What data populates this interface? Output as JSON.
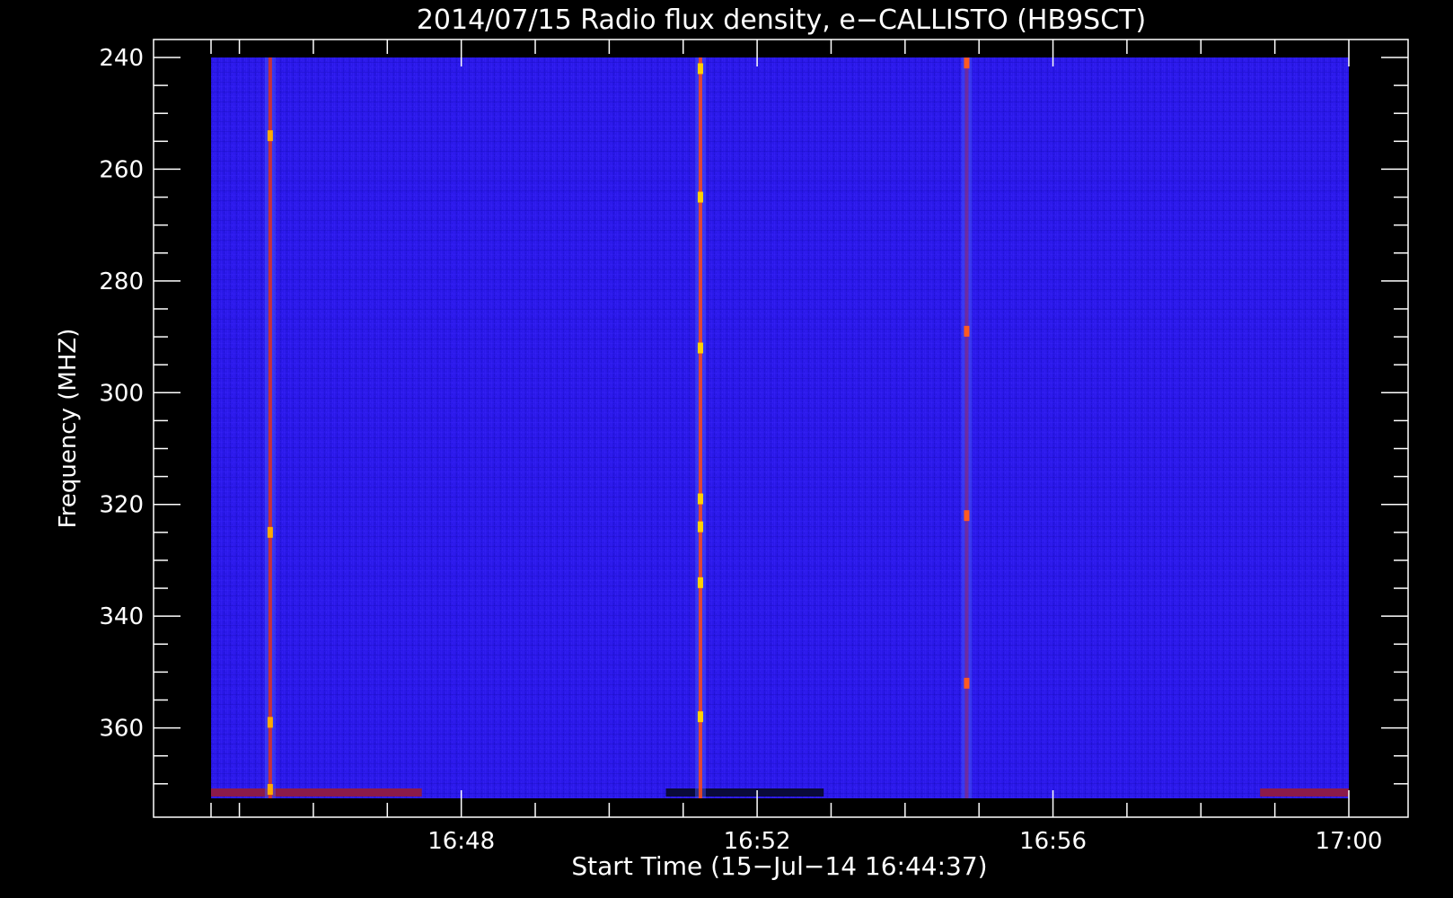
{
  "chart_data": {
    "type": "heatmap",
    "title": "2014/07/15  Radio flux density, e−CALLISTO (HB9SCT)",
    "xlabel": "Start Time (15−Jul−14 16:44:37)",
    "ylabel": "Frequency (MHZ)",
    "x_start": "16:44:37",
    "x_end": "17:00:00",
    "xlim": [
      "16:44:37",
      "17:00:00"
    ],
    "x_ticks": [
      "16:48",
      "16:52",
      "16:56",
      "17:00"
    ],
    "x_minor_tick_minutes": 1,
    "ylim": [
      240,
      372.6
    ],
    "y_inverted": true,
    "y_ticks": [
      240,
      260,
      280,
      300,
      320,
      340,
      360
    ],
    "y_tick_labels": [
      "240",
      "260",
      "280",
      "300",
      "320",
      "340",
      "360"
    ],
    "y_minor_tick_step": 5,
    "colormap": [
      "#000000",
      "#1e0ae0",
      "#3c14ff",
      "#b31c1c",
      "#ff3300",
      "#ffcc00",
      "#ffffff"
    ],
    "background_color": "#2a18e8",
    "bursts": [
      {
        "time": "16:45:25",
        "freq_range": [
          240,
          372.6
        ],
        "intensity": "medium",
        "bright_spots_mhz": [
          254,
          325,
          359,
          371
        ]
      },
      {
        "time": "16:51:14",
        "freq_range": [
          240,
          372.6
        ],
        "intensity": "high",
        "bright_spots_mhz": [
          242,
          265,
          292,
          319,
          324,
          334,
          358
        ]
      },
      {
        "time": "16:54:50",
        "freq_range": [
          240,
          372.6
        ],
        "intensity": "low",
        "bright_spots_mhz": [
          241,
          289,
          322,
          352
        ]
      }
    ],
    "bottom_band_segments": [
      {
        "start": "16:44:37",
        "end": "16:47:28",
        "color": "#8b1a4a"
      },
      {
        "start": "16:50:46",
        "end": "16:52:54",
        "color": "#0a0a3a"
      },
      {
        "start": "16:58:48",
        "end": "17:00:00",
        "color": "#8b1a4a"
      }
    ]
  }
}
